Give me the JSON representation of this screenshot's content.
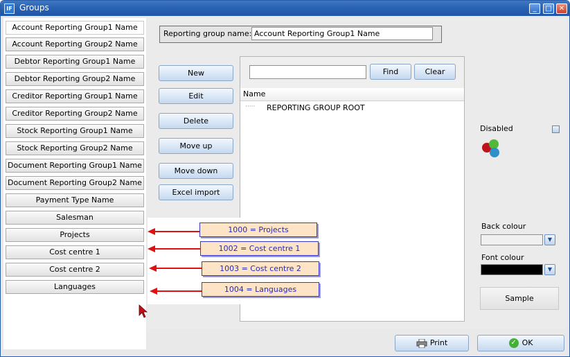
{
  "window": {
    "title": "Groups",
    "app_icon": "app-logo-icon"
  },
  "groups": [
    "Account Reporting Group1 Name",
    "Account Reporting Group2 Name",
    "Debtor Reporting Group1 Name",
    "Debtor Reporting Group2 Name",
    "Creditor Reporting Group1 Name",
    "Creditor Reporting Group2 Name",
    "Stock Reporting Group1 Name",
    "Stock Reporting Group2 Name",
    "Document Reporting Group1 Name",
    "Document Reporting Group2 Name",
    "Payment Type Name",
    "Salesman",
    "Projects",
    "Cost centre 1",
    "Cost centre 2",
    "Languages"
  ],
  "reporting": {
    "label": "Reporting group name:",
    "value": "Account Reporting Group1 Name"
  },
  "actions": [
    "New",
    "Edit",
    "Delete",
    "Move up",
    "Move down",
    "Excel import"
  ],
  "search": {
    "value": "",
    "find_label": "Find",
    "clear_label": "Clear"
  },
  "tree": {
    "header": "Name",
    "root": "REPORTING GROUP ROOT"
  },
  "options": {
    "disabled_label": "Disabled",
    "back_colour_label": "Back colour",
    "font_colour_label": "Font colour",
    "sample_label": "Sample",
    "back_colour": "#f0f0f0",
    "font_colour": "#000000"
  },
  "annotations": [
    "1000 = Projects",
    "1002 = Cost centre 1",
    "1003 = Cost centre 2",
    "1004 = Languages"
  ],
  "footer": {
    "print_label": "Print",
    "ok_label": "OK"
  },
  "colors": {
    "titlebar": "#2a63b4",
    "annotation_fill": "#fde4c6",
    "annotation_text": "#2a2ab0",
    "arrow": "#e01010"
  }
}
